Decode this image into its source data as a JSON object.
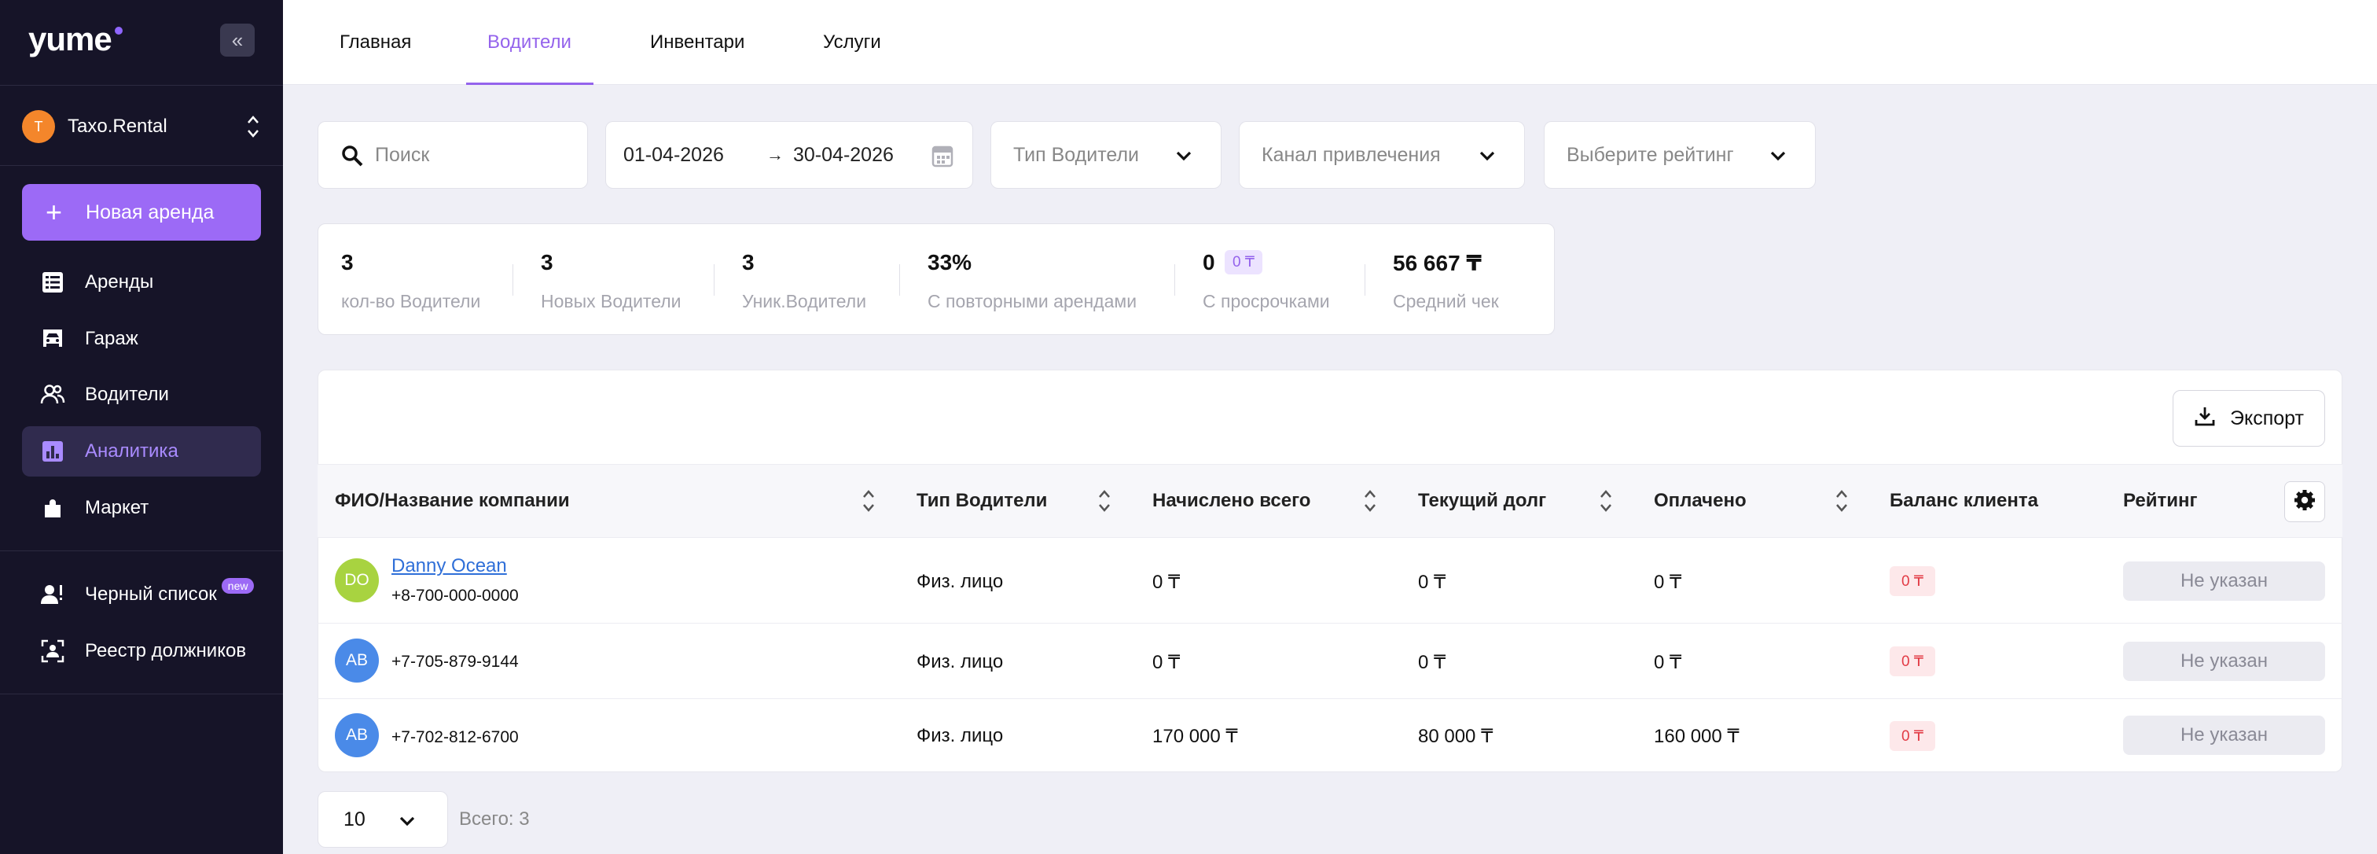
{
  "brand": {
    "logo_text": "yume",
    "accent": "#9c6af6"
  },
  "sidebar": {
    "org": {
      "initial": "T",
      "name": "Taxo.Rental"
    },
    "new_rent_label": "Новая аренда",
    "items": [
      {
        "label": "Аренды",
        "icon": "list-icon"
      },
      {
        "label": "Гараж",
        "icon": "car-icon"
      },
      {
        "label": "Водители",
        "icon": "users-icon"
      },
      {
        "label": "Аналитика",
        "icon": "chart-icon",
        "active": true
      },
      {
        "label": "Маркет",
        "icon": "puzzle-icon"
      }
    ],
    "secondary": [
      {
        "label": "Черный список",
        "badge": "new",
        "icon": "user-alert-icon"
      },
      {
        "label": "Реестр должников",
        "icon": "scan-user-icon"
      }
    ]
  },
  "tabs": [
    {
      "label": "Главная"
    },
    {
      "label": "Водители",
      "active": true
    },
    {
      "label": "Инвентари"
    },
    {
      "label": "Услуги"
    }
  ],
  "filters": {
    "search_placeholder": "Поиск",
    "date_from": "01-04-2026",
    "date_to": "30-04-2026",
    "driver_type_placeholder": "Тип Водители",
    "channel_placeholder": "Канал привлечения",
    "rating_placeholder": "Выберите рейтинг"
  },
  "stats": [
    {
      "value": "3",
      "label": "кол-во Водители"
    },
    {
      "value": "3",
      "label": "Новых Водители"
    },
    {
      "value": "3",
      "label": "Уник.Водители"
    },
    {
      "value": "33%",
      "label": "С повторными арендами"
    },
    {
      "value": "0",
      "label": "С просрочками",
      "pill": "0 ₸"
    },
    {
      "value": "56 667 ₸",
      "label": "Средний чек"
    }
  ],
  "table": {
    "export_label": "Экспорт",
    "columns": [
      "ФИО/Название компании",
      "Тип Водители",
      "Начислено всего",
      "Текущий долг",
      "Оплачено",
      "Баланс клиента",
      "Рейтинг"
    ],
    "rows": [
      {
        "initials": "DO",
        "avatar_color": "#a8d340",
        "name": "Danny Ocean",
        "phone": "+8-700-000-0000",
        "type": "Физ. лицо",
        "accrued": "0 ₸",
        "debt": "0 ₸",
        "paid": "0 ₸",
        "balance": "0 ₸",
        "rating": "Не указан"
      },
      {
        "initials": "AB",
        "avatar_color": "#4a8ae8",
        "name": "",
        "phone": "+7-705-879-9144",
        "type": "Физ. лицо",
        "accrued": "0 ₸",
        "debt": "0 ₸",
        "paid": "0 ₸",
        "balance": "0 ₸",
        "rating": "Не указан"
      },
      {
        "initials": "AB",
        "avatar_color": "#4a8ae8",
        "name": "",
        "phone": "+7-702-812-6700",
        "type": "Физ. лицо",
        "accrued": "170 000 ₸",
        "debt": "80 000 ₸",
        "paid": "160 000 ₸",
        "balance": "0 ₸",
        "rating": "Не указан"
      }
    ]
  },
  "pagination": {
    "page_size": "10",
    "total": "Всего: 3"
  }
}
